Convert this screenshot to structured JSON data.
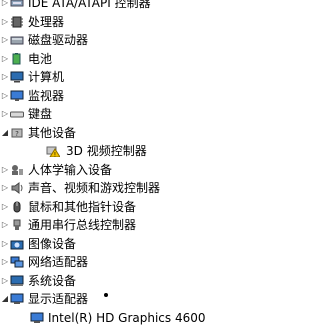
{
  "device_tree": {
    "items": [
      {
        "label": "IDE ATA/ATAPI 控制器",
        "icon": "ide-controller-icon",
        "expanded": false
      },
      {
        "label": "处理器",
        "icon": "processor-icon",
        "expanded": false
      },
      {
        "label": "磁盘驱动器",
        "icon": "disk-drive-icon",
        "expanded": false
      },
      {
        "label": "电池",
        "icon": "battery-icon",
        "expanded": false
      },
      {
        "label": "计算机",
        "icon": "computer-icon",
        "expanded": false
      },
      {
        "label": "监视器",
        "icon": "monitor-icon",
        "expanded": false
      },
      {
        "label": "键盘",
        "icon": "keyboard-icon",
        "expanded": false
      },
      {
        "label": "其他设备",
        "icon": "other-devices-icon",
        "expanded": true
      },
      {
        "label": "3D 视频控制器",
        "icon": "warning-device-icon",
        "child": true
      },
      {
        "label": "人体学输入设备",
        "icon": "hid-icon",
        "expanded": false
      },
      {
        "label": "声音、视频和游戏控制器",
        "icon": "sound-icon",
        "expanded": false
      },
      {
        "label": "鼠标和其他指针设备",
        "icon": "mouse-icon",
        "expanded": false
      },
      {
        "label": "通用串行总线控制器",
        "icon": "usb-icon",
        "expanded": false
      },
      {
        "label": "图像设备",
        "icon": "imaging-icon",
        "expanded": false
      },
      {
        "label": "网络适配器",
        "icon": "network-icon",
        "expanded": false
      },
      {
        "label": "系统设备",
        "icon": "system-icon",
        "expanded": false
      },
      {
        "label": "显示适配器",
        "icon": "display-adapter-icon",
        "expanded": true
      },
      {
        "label": "Intel(R) HD Graphics 4600",
        "icon": "display-adapter-icon",
        "child": true
      }
    ]
  },
  "colors": {
    "icon_blue": "#2b6cb0",
    "icon_gray": "#777777",
    "warning_yellow": "#f2c200"
  }
}
